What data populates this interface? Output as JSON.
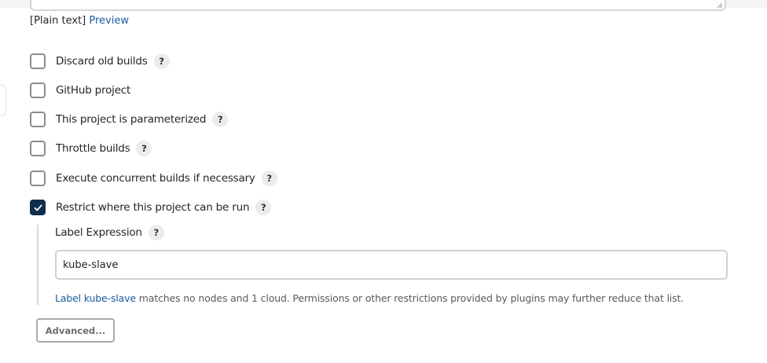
{
  "description_format": {
    "plain_label": "[Plain text]",
    "preview_link": "Preview"
  },
  "options": [
    {
      "label": "Discard old builds",
      "checked": false,
      "has_help": true
    },
    {
      "label": "GitHub project",
      "checked": false,
      "has_help": false
    },
    {
      "label": "This project is parameterized",
      "checked": false,
      "has_help": true
    },
    {
      "label": "Throttle builds",
      "checked": false,
      "has_help": true
    },
    {
      "label": "Execute concurrent builds if necessary",
      "checked": false,
      "has_help": true
    },
    {
      "label": "Restrict where this project can be run",
      "checked": true,
      "has_help": true
    }
  ],
  "help_symbol": "?",
  "label_expression": {
    "title": "Label Expression",
    "value": "kube-slave",
    "validation_link": "Label kube-slave",
    "validation_text": " matches no nodes and 1 cloud. Permissions or other restrictions provided by plugins may further reduce that list."
  },
  "advanced_button": "Advanced...",
  "colors": {
    "checkbox_checked": "#0f2e4d",
    "link": "#1b5b9e"
  }
}
